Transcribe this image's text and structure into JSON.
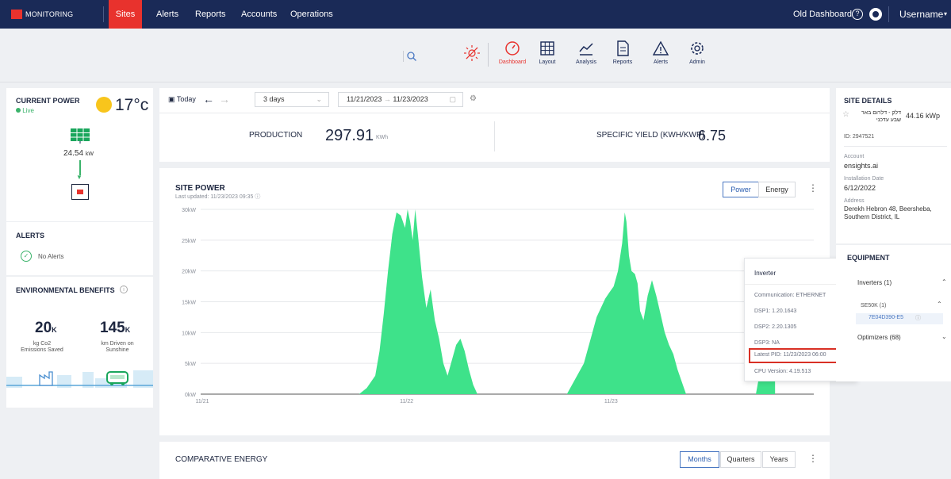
{
  "nav": {
    "brand": "MONITORING",
    "items": [
      "Sites",
      "Alerts",
      "Reports",
      "Accounts",
      "Operations"
    ],
    "old_dashboard": "Old Dashboard",
    "username": "Username"
  },
  "toolbar": {
    "items": [
      "Dashboard",
      "Layout",
      "Analysis",
      "Reports",
      "Alerts",
      "Admin"
    ]
  },
  "current_power": {
    "title": "CURRENT POWER",
    "live": "Live",
    "temperature": "17°c",
    "panel_power": "24.54",
    "panel_unit": "kW"
  },
  "alerts": {
    "title": "ALERTS",
    "status": "No Alerts"
  },
  "env": {
    "title": "ENVIRONMENTAL BENEFITS",
    "co2_value": "20",
    "co2_unit": "K",
    "co2_label": "kg Co2 Emissions Saved",
    "km_value": "145",
    "km_unit": "K",
    "km_label": "km Driven on Sunshine"
  },
  "filters": {
    "today": "Today",
    "range": "3 days",
    "date_from": "11/21/2023",
    "date_to": "11/23/2023"
  },
  "production": {
    "label": "PRODUCTION",
    "value": "297.91",
    "unit": "KWh",
    "yield_label": "SPECIFIC YIELD (KWH/KWP)",
    "yield_value": "6.75"
  },
  "site_power": {
    "title": "SITE POWER",
    "last_updated": "Last updated: 11/23/2023 09:35",
    "btn_power": "Power",
    "btn_energy": "Energy"
  },
  "chart_data": {
    "type": "area",
    "y_tick_labels": [
      "0kW",
      "5kW",
      "10kW",
      "15kW",
      "20kW",
      "25kW",
      "30kW"
    ],
    "ylim": [
      0,
      30
    ],
    "x_tick_labels": [
      "11/21",
      "11/22",
      "11/23"
    ],
    "xlim": [
      0,
      72
    ],
    "color": "#3ee28a",
    "series": [
      {
        "x": [
          18.6,
          19.5,
          20.5,
          21.0,
          21.5,
          22.0,
          22.5,
          23.0,
          23.5,
          24.0,
          24.3,
          24.6,
          24.9,
          25.2,
          25.5,
          26.0,
          26.5,
          27.0,
          27.5,
          28.0,
          28.5,
          29.0,
          29.5,
          30.0,
          30.5,
          31.0,
          31.5,
          32.0,
          32.5
        ],
        "y": [
          0,
          1.0,
          3.0,
          7.0,
          13.0,
          20.0,
          26.0,
          29.5,
          29.0,
          27.0,
          30.0,
          28.0,
          25.0,
          30.0,
          26.0,
          19.0,
          14.0,
          17.0,
          12.0,
          9.0,
          5.0,
          3.0,
          5.5,
          8.0,
          9.0,
          7.0,
          4.0,
          1.5,
          0
        ]
      },
      {
        "x": [
          43.0,
          44.0,
          45.0,
          45.5,
          46.0,
          46.5,
          47.0,
          47.5,
          48.0,
          48.5,
          49.0,
          49.5,
          49.8,
          50.0,
          50.3,
          50.6,
          51.0,
          51.3,
          51.6,
          52.0,
          52.5,
          53.0,
          53.5,
          54.0,
          54.5,
          55.0,
          55.5,
          56.0,
          56.5,
          57.0
        ],
        "y": [
          0,
          2.5,
          5.0,
          7.5,
          10.0,
          12.5,
          14.0,
          15.5,
          16.5,
          17.5,
          20.0,
          24.5,
          29.5,
          28.0,
          22.5,
          20.0,
          19.5,
          18.0,
          13.5,
          12.0,
          16.0,
          18.5,
          16.0,
          13.0,
          10.0,
          8.0,
          6.5,
          4.0,
          2.0,
          0
        ]
      },
      {
        "x": [
          65.2,
          66.0,
          66.5,
          67.0,
          67.4,
          67.45
        ],
        "y": [
          0,
          6.0,
          11.0,
          16.0,
          20.5,
          0
        ]
      }
    ]
  },
  "inverter_popup": {
    "title": "Inverter",
    "communication": "Communication: ETHERNET",
    "dsp1": "DSP1: 1.20.1643",
    "dsp2": "DSP2: 2.20.1305",
    "dsp3": "DSP3: NA",
    "latest_pid": "Latest PID: 11/23/2023 06:00",
    "cpu_version": "CPU Version: 4.19.513",
    "highlight_color": "#d93025"
  },
  "comparative": {
    "title": "COMPARATIVE ENERGY",
    "btn_months": "Months",
    "btn_quarters": "Quarters",
    "btn_years": "Years"
  },
  "site_details": {
    "title": "SITE DETAILS",
    "name": "דלק - דלרום באר שבע עדכני",
    "capacity": "44.16 kWp",
    "id": "ID: 2947521",
    "account_label": "Account",
    "account_value": "ensights.ai",
    "install_label": "Installation Date",
    "install_value": "6/12/2022",
    "address_label": "Address",
    "address_value": "Derekh Hebron 48, Beersheba, Southern District, IL"
  },
  "equipment": {
    "title": "EQUIPMENT",
    "inverters": "Inverters (1)",
    "se50k": "SE50K (1)",
    "serial": "7E04D390-E5",
    "optimizers": "Optimizers (68)"
  }
}
